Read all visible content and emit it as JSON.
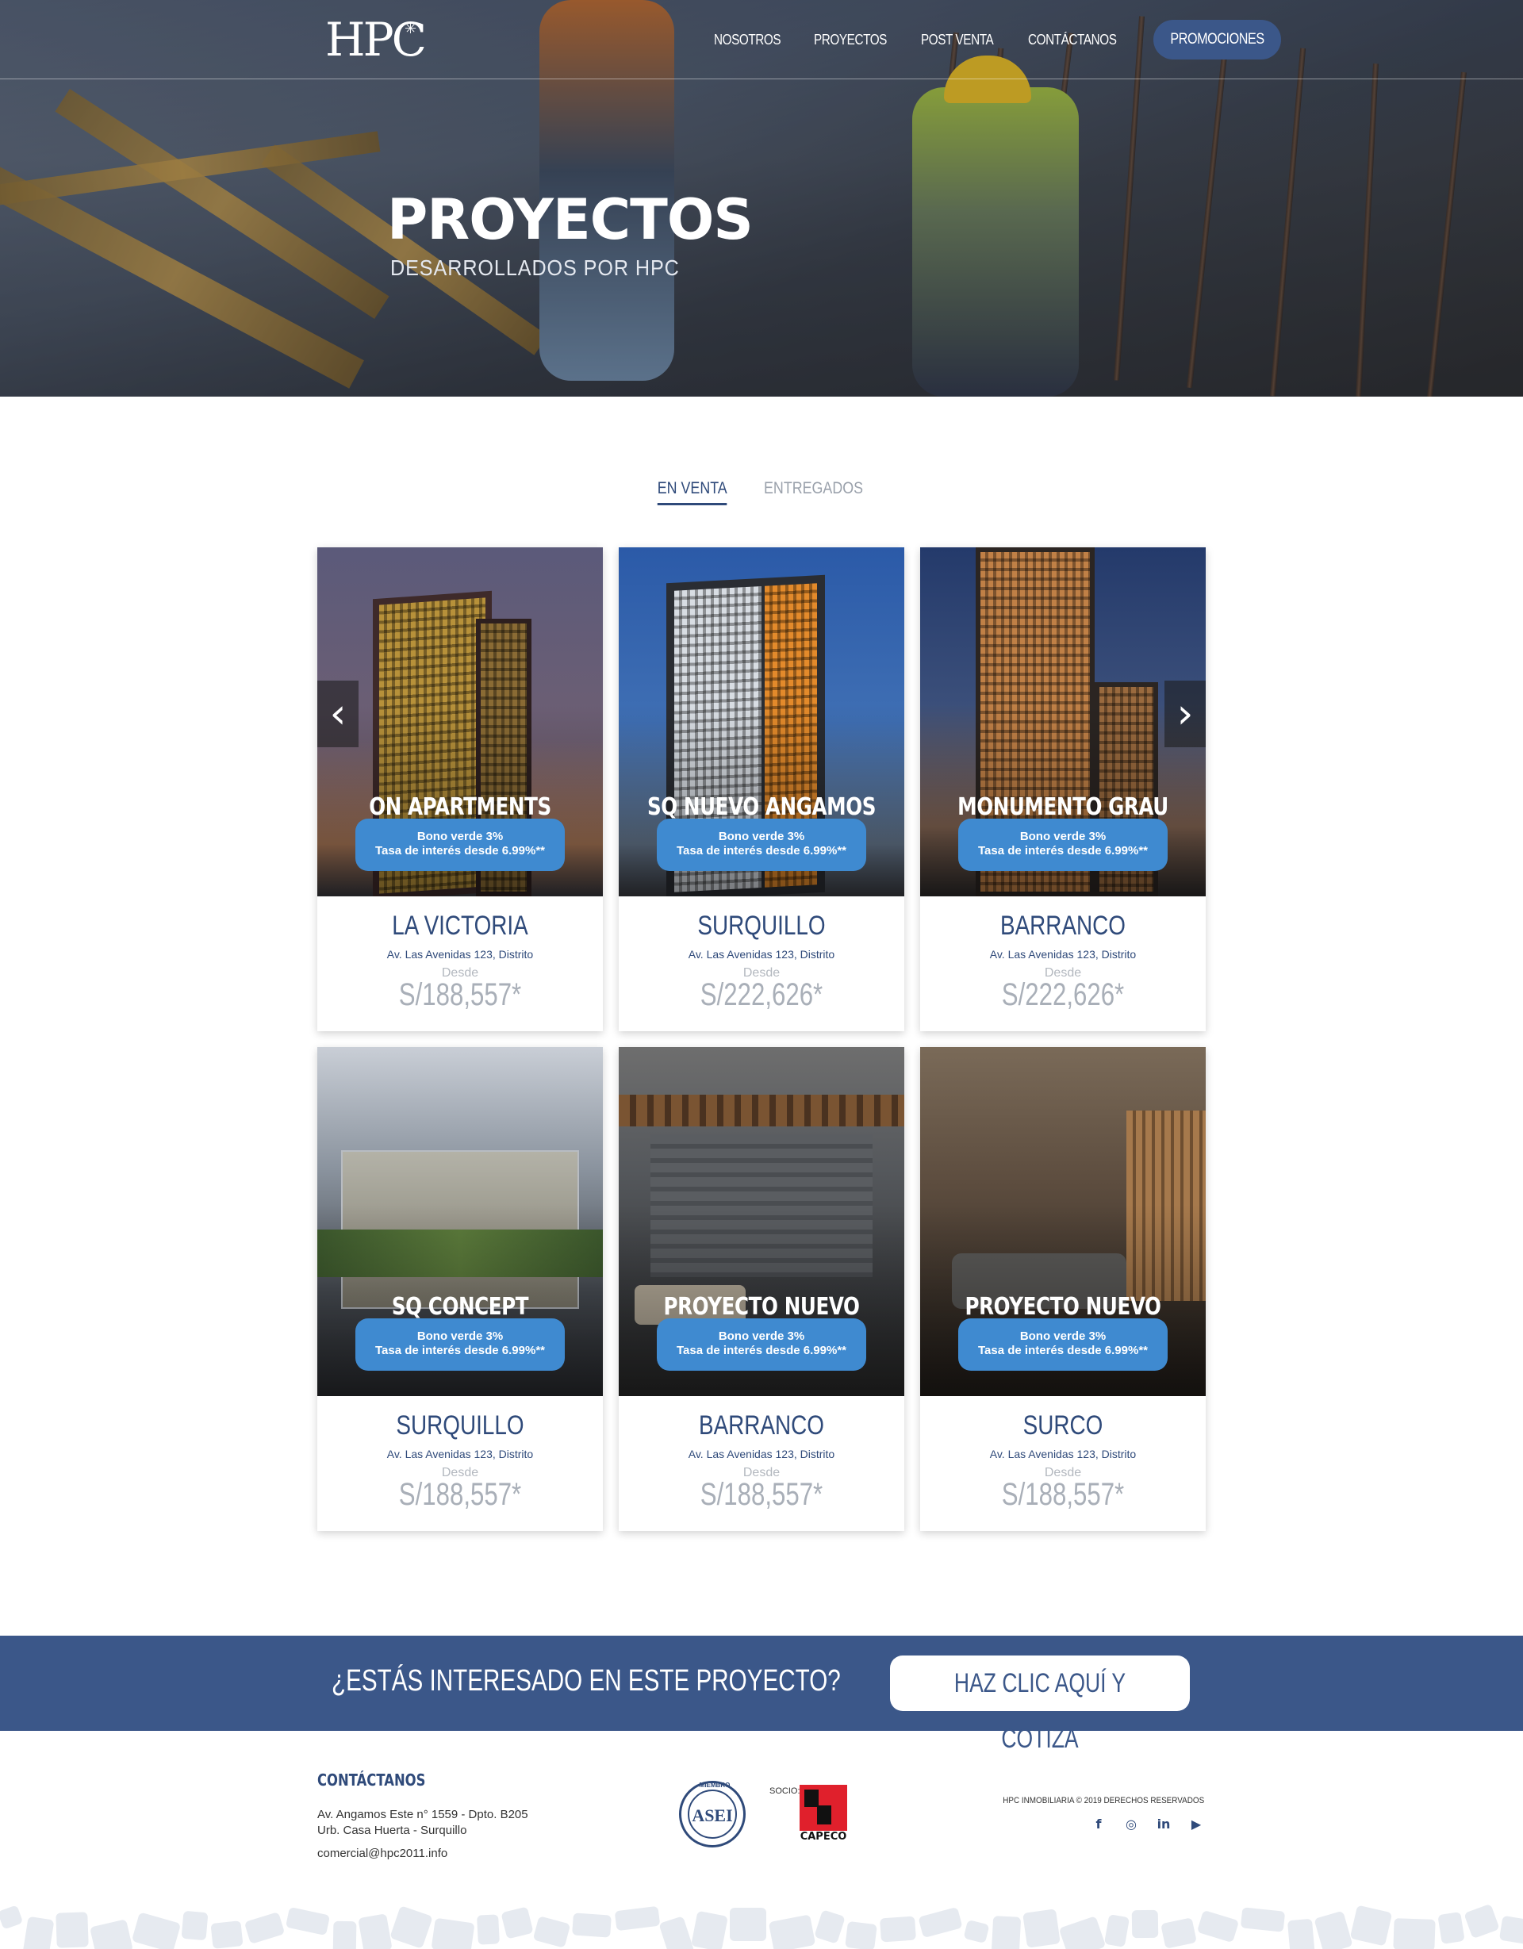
{
  "brand": {
    "logo_text": "HPC"
  },
  "nav": {
    "items": [
      "NOSOTROS",
      "PROYECTOS",
      "POST VENTA",
      "CONTÁCTANOS"
    ],
    "promo_label": "PROMOCIONES"
  },
  "hero": {
    "title": "PROYECTOS",
    "subtitle": "DESARROLLADOS POR HPC"
  },
  "tabs": [
    {
      "label": "EN VENTA",
      "active": true
    },
    {
      "label": "ENTREGADOS",
      "active": false
    }
  ],
  "projects": [
    {
      "name": "ON APARTMENTS",
      "badge_line1": "Bono verde 3%",
      "badge_line2": "Tasa de interés desde 6.99%**",
      "district": "LA VICTORIA",
      "address": "Av. Las Avenidas 123, Distrito",
      "from_label": "Desde",
      "price": "S/188,557*"
    },
    {
      "name": "SQ NUEVO ANGAMOS",
      "badge_line1": "Bono verde 3%",
      "badge_line2": "Tasa de interés desde 6.99%**",
      "district": "SURQUILLO",
      "address": "Av. Las Avenidas 123, Distrito",
      "from_label": "Desde",
      "price": "S/222,626*"
    },
    {
      "name": "MONUMENTO GRAU",
      "badge_line1": "Bono verde 3%",
      "badge_line2": "Tasa de interés desde 6.99%**",
      "district": "BARRANCO",
      "address": "Av. Las Avenidas 123, Distrito",
      "from_label": "Desde",
      "price": "S/222,626*"
    },
    {
      "name": "SQ CONCEPT",
      "badge_line1": "Bono verde 3%",
      "badge_line2": "Tasa de interés desde 6.99%**",
      "district": "SURQUILLO",
      "address": "Av. Las Avenidas 123, Distrito",
      "from_label": "Desde",
      "price": "S/188,557*"
    },
    {
      "name": "PROYECTO NUEVO",
      "badge_line1": "Bono verde 3%",
      "badge_line2": "Tasa de interés desde 6.99%**",
      "district": "BARRANCO",
      "address": "Av. Las Avenidas 123, Distrito",
      "from_label": "Desde",
      "price": "S/188,557*"
    },
    {
      "name": "PROYECTO NUEVO",
      "badge_line1": "Bono verde 3%",
      "badge_line2": "Tasa de interés desde 6.99%**",
      "district": "SURCO",
      "address": "Av. Las Avenidas 123, Distrito",
      "from_label": "Desde",
      "price": "S/188,557*"
    }
  ],
  "carousel": {
    "prev_icon": "chevron-left-icon",
    "next_icon": "chevron-right-icon",
    "prev_glyph": "‹",
    "next_glyph": "›"
  },
  "cta": {
    "question": "¿ESTÁS INTERESADO EN ESTE PROYECTO?",
    "button_label": "HAZ CLIC AQUÍ Y COTIZA"
  },
  "footer": {
    "contact_title": "CONTÁCTANOS",
    "address_line1": "Av. Angamos Este n° 1559 - Dpto. B205",
    "address_line2": "Urb. Casa Huerta - Surquillo",
    "email": "comercial@hpc2011.info",
    "asei_label": "ASEI",
    "asei_ring": "MIEMBRO",
    "socio_label": "SOCIO:",
    "capeco_label": "CAPECO",
    "copyright": "HPC INMOBILIARIA © 2019 DERECHOS RESERVADOS",
    "socials": [
      {
        "icon": "facebook-icon",
        "glyph": "f"
      },
      {
        "icon": "instagram-icon",
        "glyph": "◎"
      },
      {
        "icon": "linkedin-icon",
        "glyph": "in"
      },
      {
        "icon": "youtube-icon",
        "glyph": "▶"
      }
    ]
  },
  "colors": {
    "brand_blue": "#3b5789",
    "accent_blue": "#3f8ad0",
    "text_blue": "#2f4a7a",
    "muted_gray": "#a9afb8"
  }
}
